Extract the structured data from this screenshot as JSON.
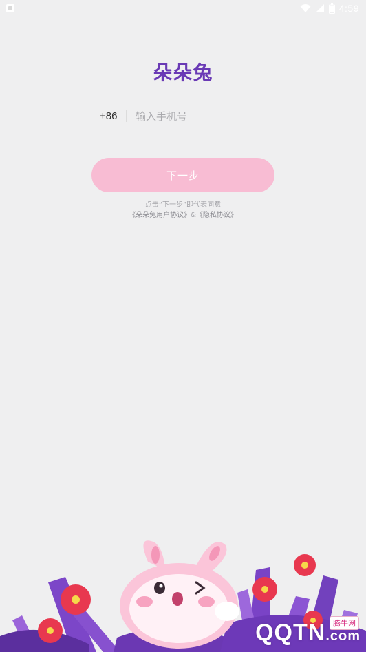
{
  "status_bar": {
    "time": "4:59"
  },
  "logo": {
    "text": "朵朵兔"
  },
  "phone": {
    "country_code": "+86",
    "placeholder": "输入手机号",
    "value": ""
  },
  "next_button": {
    "label": "下一步"
  },
  "agreement": {
    "line1": "点击“下一步”即代表同意",
    "user_agreement": "《朵朵兔用户协议》",
    "and": "&",
    "privacy_policy": "《隐私协议》"
  },
  "watermark": {
    "text": "QQTN",
    "suffix": ".com",
    "badge": "腾牛网"
  },
  "colors": {
    "background": "#efeff0",
    "logo": "#6a3ab5",
    "button": "#f8bcd3",
    "button_text": "#ffffff"
  },
  "icons": {
    "status_left": "notification-icon",
    "status_right": [
      "wifi-icon",
      "signal-icon",
      "battery-icon"
    ],
    "illustration": "bunny-flowers-illustration"
  }
}
